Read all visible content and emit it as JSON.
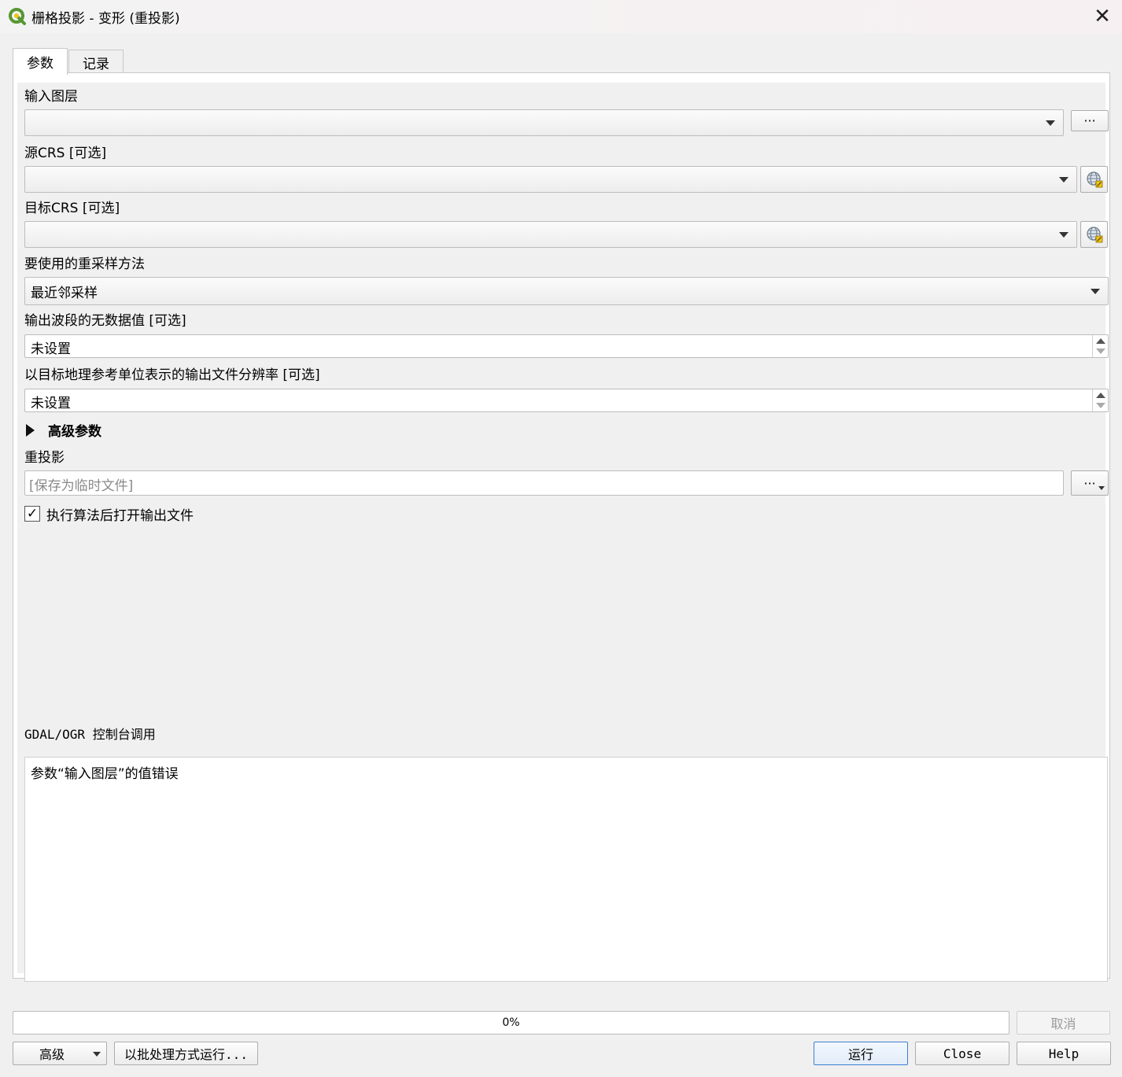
{
  "window": {
    "title": "栅格投影 - 变形 (重投影)",
    "close_glyph": "✕"
  },
  "tabs": [
    {
      "label": "参数"
    },
    {
      "label": "记录"
    }
  ],
  "form": {
    "input_layer_label": "输入图层",
    "input_layer_value": "",
    "browse_glyph": "···",
    "source_crs_label": "源CRS [可选]",
    "source_crs_value": "",
    "target_crs_label": "目标CRS [可选]",
    "target_crs_value": "",
    "resampling_label": "要使用的重采样方法",
    "resampling_value": "最近邻采样",
    "nodata_label": "输出波段的无数据值 [可选]",
    "nodata_value": "未设置",
    "resolution_label": "以目标地理参考单位表示的输出文件分辨率 [可选]",
    "resolution_value": "未设置",
    "advanced_label": "高级参数",
    "reprojected_label": "重投影",
    "reprojected_placeholder": "[保存为临时文件]",
    "open_output_label": "执行算法后打开输出文件",
    "open_output_checked": "✓",
    "console_label": "GDAL/OGR 控制台调用",
    "console_text": "参数“输入图层”的值错误"
  },
  "footer": {
    "progress_text": "0%",
    "cancel_label": "取消",
    "advanced_label": "高级",
    "batch_label": "以批处理方式运行...",
    "run_label": "运行",
    "close_label": "Close",
    "help_label": "Help"
  },
  "icons": {
    "app": "qgis-logo-icon",
    "crs": "globe-crs-icon"
  },
  "colors": {
    "qgis_green": "#589632",
    "qgis_yellow": "#f0c419",
    "focus_blue": "#3c7fd4"
  }
}
